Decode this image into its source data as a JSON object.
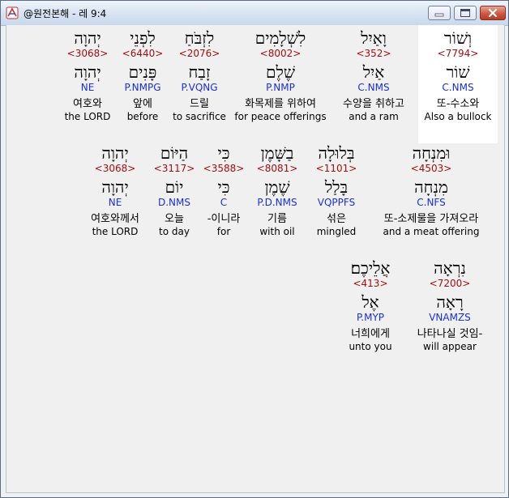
{
  "window": {
    "title": "@원전본해 - 레 9:4"
  },
  "colors": {
    "strong": "#a01010",
    "parse": "#1c2fd0",
    "highlight": "#ffffff"
  },
  "words": [
    {
      "heb": "וְשׁוֹר",
      "strong": "<7794>",
      "lemma": "שׁוֹר",
      "parse": "C.NMS",
      "kor": "또-수소와",
      "eng": "Also a bullock",
      "highlight": true
    },
    {
      "heb": "וָאַיִל",
      "strong": "<352>",
      "lemma": "אַיִל",
      "parse": "C.NMS",
      "kor": "수양을 취하고",
      "eng": "and a ram",
      "highlight": false
    },
    {
      "heb": "לִשְׁלָמִים",
      "strong": "<8002>",
      "lemma": "שֶׁלֶם",
      "parse": "P.NMP",
      "kor": "화목제를 위하여",
      "eng": "for peace offerings",
      "highlight": false
    },
    {
      "heb": "לִזְבֹּחַ",
      "strong": "<2076>",
      "lemma": "זָבַח",
      "parse": "P.VQNG",
      "kor": "드릴",
      "eng": "to sacrifice",
      "highlight": false
    },
    {
      "heb": "לִפְנֵי",
      "strong": "<6440>",
      "lemma": "פָּנִים",
      "parse": "P.NMPG",
      "kor": "앞에",
      "eng": "before",
      "highlight": false
    },
    {
      "heb": "יְהוָה",
      "strong": "<3068>",
      "lemma": "יְהוָה",
      "parse": "NE",
      "kor": "여호와",
      "eng": "the LORD",
      "highlight": false
    },
    {
      "heb": "וּמִנְחָה",
      "strong": "<4503>",
      "lemma": "מִנְחָה",
      "parse": "C.NFS",
      "kor": "또-소제물을 가져오라",
      "eng": "and a meat offering",
      "highlight": false
    },
    {
      "heb": "בְּלוּלָה",
      "strong": "<1101>",
      "lemma": "בָּלַל",
      "parse": "VQPPFS",
      "kor": "섞은",
      "eng": "mingled",
      "highlight": false
    },
    {
      "heb": "בַשָּׁמֶן",
      "strong": "<8081>",
      "lemma": "שֶׁמֶן",
      "parse": "P.D.NMS",
      "kor": "기름",
      "eng": "with oil",
      "highlight": false
    },
    {
      "heb": "כִּי",
      "strong": "<3588>",
      "lemma": "כִּי",
      "parse": "C",
      "kor": "-이니라",
      "eng": "for",
      "highlight": false
    },
    {
      "heb": "הַיּוֹם",
      "strong": "<3117>",
      "lemma": "יוֹם",
      "parse": "D.NMS",
      "kor": "오늘",
      "eng": "to day",
      "highlight": false
    },
    {
      "heb": "יְהוָה",
      "strong": "<3068>",
      "lemma": "יְהוָה",
      "parse": "NE",
      "kor": "여호와께서",
      "eng": "the LORD",
      "highlight": false
    },
    {
      "heb": "נִרְאָה",
      "strong": "<7200>",
      "lemma": "רָאָה",
      "parse": "VNAMZS",
      "kor": "나타나실 것임-",
      "eng": "will appear",
      "highlight": false
    },
    {
      "heb": "אֲלֵיכֶם׃",
      "strong": "<413>",
      "lemma": "אֶל",
      "parse": "P.MYP",
      "kor": "너희에게",
      "eng": "unto you",
      "highlight": false
    }
  ]
}
